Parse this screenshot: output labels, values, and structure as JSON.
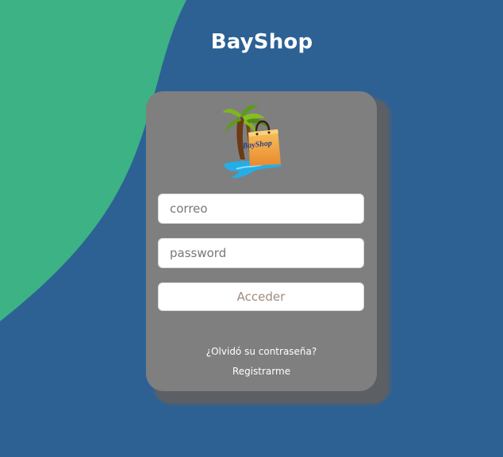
{
  "app": {
    "title": "BayShop"
  },
  "logo": {
    "text": "BayShop",
    "icon": "palm-tree-shopping-bag-logo"
  },
  "login_form": {
    "email_placeholder": "correo",
    "password_placeholder": "password",
    "submit_label": "Acceder",
    "forgot_password_link": "¿Olvidó su contraseña?",
    "register_link": "Registrarme"
  },
  "colors": {
    "background": "#2d6194",
    "accent_wave": "#3db284",
    "card": "#7f7f7f",
    "button_text": "#a08a7d"
  }
}
